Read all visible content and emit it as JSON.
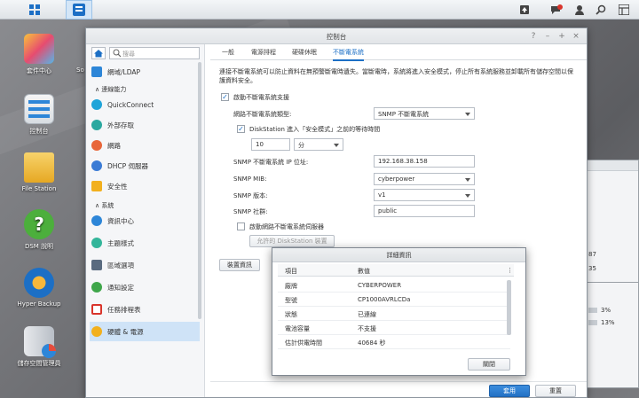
{
  "taskbar": {
    "icons": [
      "main-menu-icon",
      "control-panel-app-icon",
      "upload-icon",
      "notification-icon",
      "user-icon",
      "search-icon",
      "widget-icon"
    ]
  },
  "desktop": {
    "icons": [
      {
        "label": "套件中心",
        "short": "So"
      },
      {
        "label": "控制台"
      },
      {
        "label": "File Station"
      },
      {
        "label": "DSM 說明"
      },
      {
        "label": "Hyper Backup"
      },
      {
        "label": "儲存空間管理員"
      }
    ]
  },
  "bg_window": {
    "rows": [
      "87",
      "35"
    ],
    "stats": [
      {
        "value": "3%"
      },
      {
        "value": "13%"
      }
    ]
  },
  "window": {
    "title": "控制台"
  },
  "sidebar": {
    "search_placeholder": "搜尋",
    "item_domain": "網域/LDAP",
    "section_connectivity": "連線能力",
    "item_quickconnect": "QuickConnect",
    "item_external": "外部存取",
    "item_network": "網路",
    "item_dhcp": "DHCP 伺服器",
    "item_security": "安全性",
    "section_system": "系統",
    "item_info": "資訊中心",
    "item_theme": "主題樣式",
    "item_region": "區域選項",
    "item_notify": "通知設定",
    "item_task": "任務排程表",
    "item_hardware": "硬體 & 電源"
  },
  "tabs": {
    "general": "一般",
    "power_schedule": "電源排程",
    "hibernation": "硬碟休眠",
    "ups": "不斷電系統"
  },
  "ups": {
    "description": "連接不斷電系統可以防止資料在無預警斷電時遺失。當斷電時，系統將進入安全模式，停止所有系統服務並卸載所有儲存空間以保護資料安全。",
    "enable_label": "啟動不斷電系統支援",
    "type_label": "網路不斷電系統類型:",
    "type_value": "SNMP 不斷電系統",
    "safe_mode_label": "DiskStation 進入「安全模式」之前的等待時間",
    "wait_value": "10",
    "wait_unit": "分",
    "ip_label": "SNMP 不斷電系統 IP 位址:",
    "ip_value": "192.168.38.158",
    "mib_label": "SNMP MIB:",
    "mib_value": "cyberpower",
    "version_label": "SNMP 版本:",
    "version_value": "v1",
    "community_label": "SNMP 社群:",
    "community_value": "public",
    "server_label": "啟動網路不斷電系統伺服器",
    "permitted_button": "允許的 DiskStation 裝置",
    "device_info_button": "裝置資訊",
    "apply_button": "套用",
    "reset_button": "重置"
  },
  "dialog": {
    "title": "詳細資訊",
    "col_item": "項目",
    "col_value": "數值",
    "rows": [
      {
        "item": "廠牌",
        "value": "CYBERPOWER"
      },
      {
        "item": "型號",
        "value": "CP1000AVRLCDa"
      },
      {
        "item": "狀態",
        "value": "已連線"
      },
      {
        "item": "電池容量",
        "value": "不支援"
      },
      {
        "item": "估計供電時間",
        "value": "40684 秒"
      }
    ],
    "close_button": "關閉"
  },
  "colors": {
    "accent": "#1c6fc5",
    "apply_bg": "#2a7fd4"
  }
}
